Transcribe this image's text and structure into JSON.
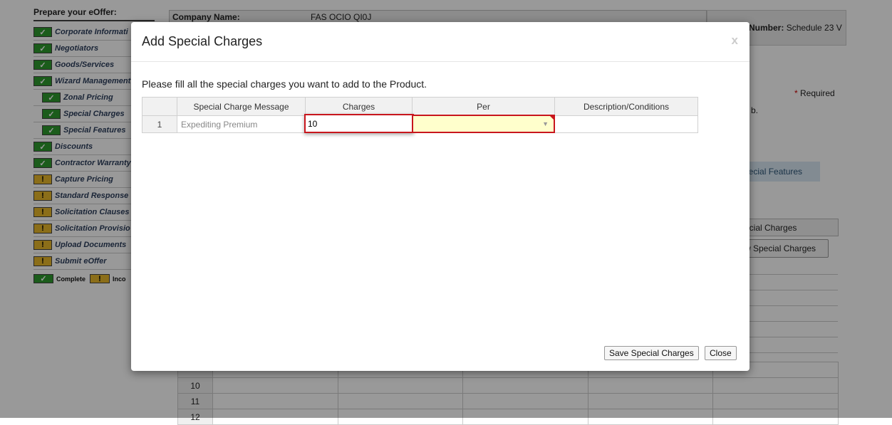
{
  "sidebar": {
    "title": "Prepare your eOffer:",
    "items": [
      {
        "label": "Corporate Informati",
        "status": "complete",
        "sub": false
      },
      {
        "label": "Negotiators",
        "status": "complete",
        "sub": false
      },
      {
        "label": "Goods/Services",
        "status": "complete",
        "sub": false
      },
      {
        "label": "Wizard Management",
        "status": "complete",
        "sub": false
      },
      {
        "label": "Zonal Pricing",
        "status": "complete",
        "sub": true
      },
      {
        "label": "Special Charges",
        "status": "complete",
        "sub": true
      },
      {
        "label": "Special Features",
        "status": "complete",
        "sub": true
      },
      {
        "label": "Discounts",
        "status": "complete",
        "sub": false
      },
      {
        "label": "Contractor Warranty",
        "status": "complete",
        "sub": false
      },
      {
        "label": "Capture Pricing",
        "status": "incomplete",
        "sub": false
      },
      {
        "label": "Standard Response",
        "status": "incomplete",
        "sub": false
      },
      {
        "label": "Solicitation Clauses",
        "status": "incomplete",
        "sub": false
      },
      {
        "label": "Solicitation Provisio",
        "status": "incomplete",
        "sub": false
      },
      {
        "label": "Upload Documents",
        "status": "incomplete",
        "sub": false
      },
      {
        "label": "Submit eOffer",
        "status": "incomplete",
        "sub": false
      }
    ],
    "legend": {
      "complete": "Complete",
      "incomplete": "Inco"
    }
  },
  "page": {
    "company_label": "Company Name:",
    "company_value": "FAS OCIO QI0J",
    "number_label": "Number:",
    "number_value": "Schedule 23 V",
    "required_star": "*",
    "required_text": "Required",
    "fragment_b": "b.",
    "special_features_button": "pecial Features",
    "special_charges_tab": "ecial Charges",
    "view_special_charges_button": "w Special Charges",
    "bg_rows": [
      "10",
      "11",
      "12"
    ]
  },
  "modal": {
    "title": "Add Special Charges",
    "close_x": "x",
    "instruction": "Please fill all the special charges you want to add to the Product.",
    "columns": [
      "Special Charge Message",
      "Charges",
      "Per",
      "Description/Conditions"
    ],
    "rows": [
      {
        "num": "1",
        "message": "Expediting Premium",
        "charges": "10",
        "per": "",
        "description": ""
      }
    ],
    "save_button": "Save Special Charges",
    "close_button": "Close"
  },
  "colors": {
    "complete": "#2e9a2e",
    "incomplete": "#e8b82a",
    "error_border": "#c8161d",
    "invalid_fill": "#ffffcc"
  },
  "icons": {
    "complete": "check-icon",
    "incomplete": "exclamation-icon",
    "dropdown": "dropdown-arrow-icon"
  }
}
